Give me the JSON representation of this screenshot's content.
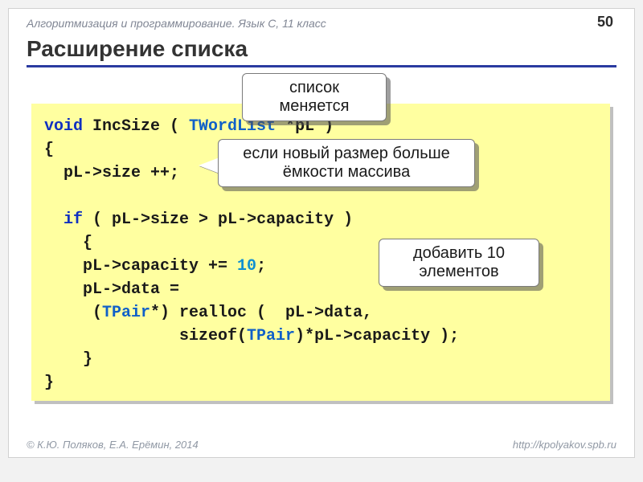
{
  "header": "Алгоритмизация и программирование. Язык C, 11 класс",
  "page_number": "50",
  "title": "Расширение списка",
  "callouts": {
    "c1": "список\nменяется",
    "c2": "если новый размер больше\nёмкости массива",
    "c3": "добавить 10\nэлементов"
  },
  "code": {
    "l1a": "void",
    "l1b": " IncSize ( ",
    "l1c": "TWordList",
    "l1d": " *pL )",
    "l2": "{",
    "l3": "  pL->size ++;",
    "l4a": "  ",
    "l4b": "if",
    "l4c": " ( pL->size > pL->capacity )",
    "l5": "    {",
    "l6a": "    pL->capacity += ",
    "l6b": "10",
    "l6c": ";",
    "l7": "    pL->data =",
    "l8a": "     (",
    "l8b": "TPair",
    "l8c": "*) realloc (  pL->data,",
    "l9a": "              sizeof(",
    "l9b": "TPair",
    "l9c": ")*pL->capacity );",
    "l10": "    }",
    "l11": "}"
  },
  "footer_left": "© К.Ю. Поляков, Е.А. Ерёмин, 2014",
  "footer_right": "http://kpolyakov.spb.ru"
}
